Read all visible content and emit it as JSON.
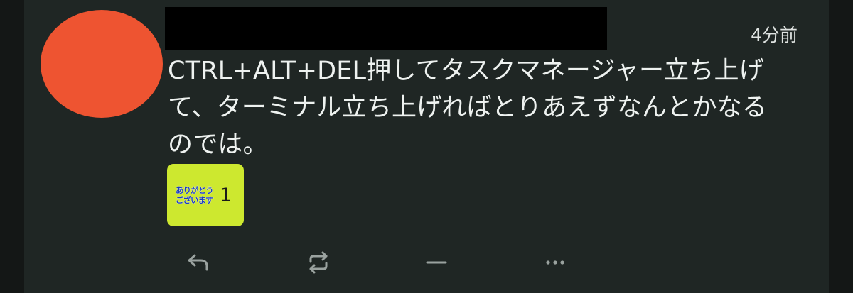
{
  "note": {
    "timestamp": "4分前",
    "content_lines": [
      "CTRL+ALT+DEL押してタスクマネージャー立ち上げ",
      "て、ターミナル立ち上げればとりあえずなんとかなる",
      "のでは。"
    ]
  },
  "reaction": {
    "stamp_lines": [
      "ありがとう",
      "ございます"
    ],
    "count": "1"
  },
  "footer": {
    "icons": [
      "reply-icon",
      "renote-icon",
      "react-icon",
      "more-icon"
    ]
  },
  "colors": {
    "avatar": "#ee5431",
    "reaction_bg": "#cde82f",
    "background": "#1f2624"
  }
}
